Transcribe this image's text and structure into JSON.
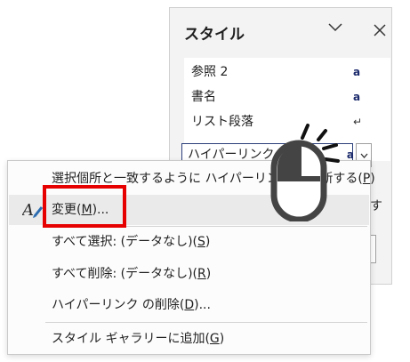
{
  "pane": {
    "title": "スタイル",
    "styles": [
      {
        "name": "参照 2",
        "mark": "a"
      },
      {
        "name": "書名",
        "mark": "a"
      },
      {
        "name": "リスト段落",
        "mark": "↵"
      }
    ],
    "selected": {
      "name": "ハイパーリンク",
      "mark": "a"
    },
    "peek_text": "す"
  },
  "menu": {
    "items": [
      {
        "prefix": "選択個所と一致するように ハイパーリンク を更新する(",
        "key": "P",
        "suffix": ")"
      },
      {
        "prefix": "変更(",
        "key": "M",
        "suffix": ")..."
      },
      {
        "prefix": "すべて選択: (データなし)(",
        "key": "S",
        "suffix": ")"
      },
      {
        "prefix": "すべて削除: (データなし)(",
        "key": "R",
        "suffix": ")"
      },
      {
        "prefix": "ハイパーリンク の削除(",
        "key": "D",
        "suffix": ")..."
      },
      {
        "prefix": "スタイル ギャラリーに追加(",
        "key": "G",
        "suffix": ")"
      }
    ]
  },
  "colors": {
    "highlight": "#e60000",
    "selected_border": "#2b3f7a",
    "pane_bg": "#f3f3f3"
  },
  "icons": [
    "chevron-down-icon",
    "close-icon",
    "modify-style-icon",
    "mouse-icon"
  ]
}
